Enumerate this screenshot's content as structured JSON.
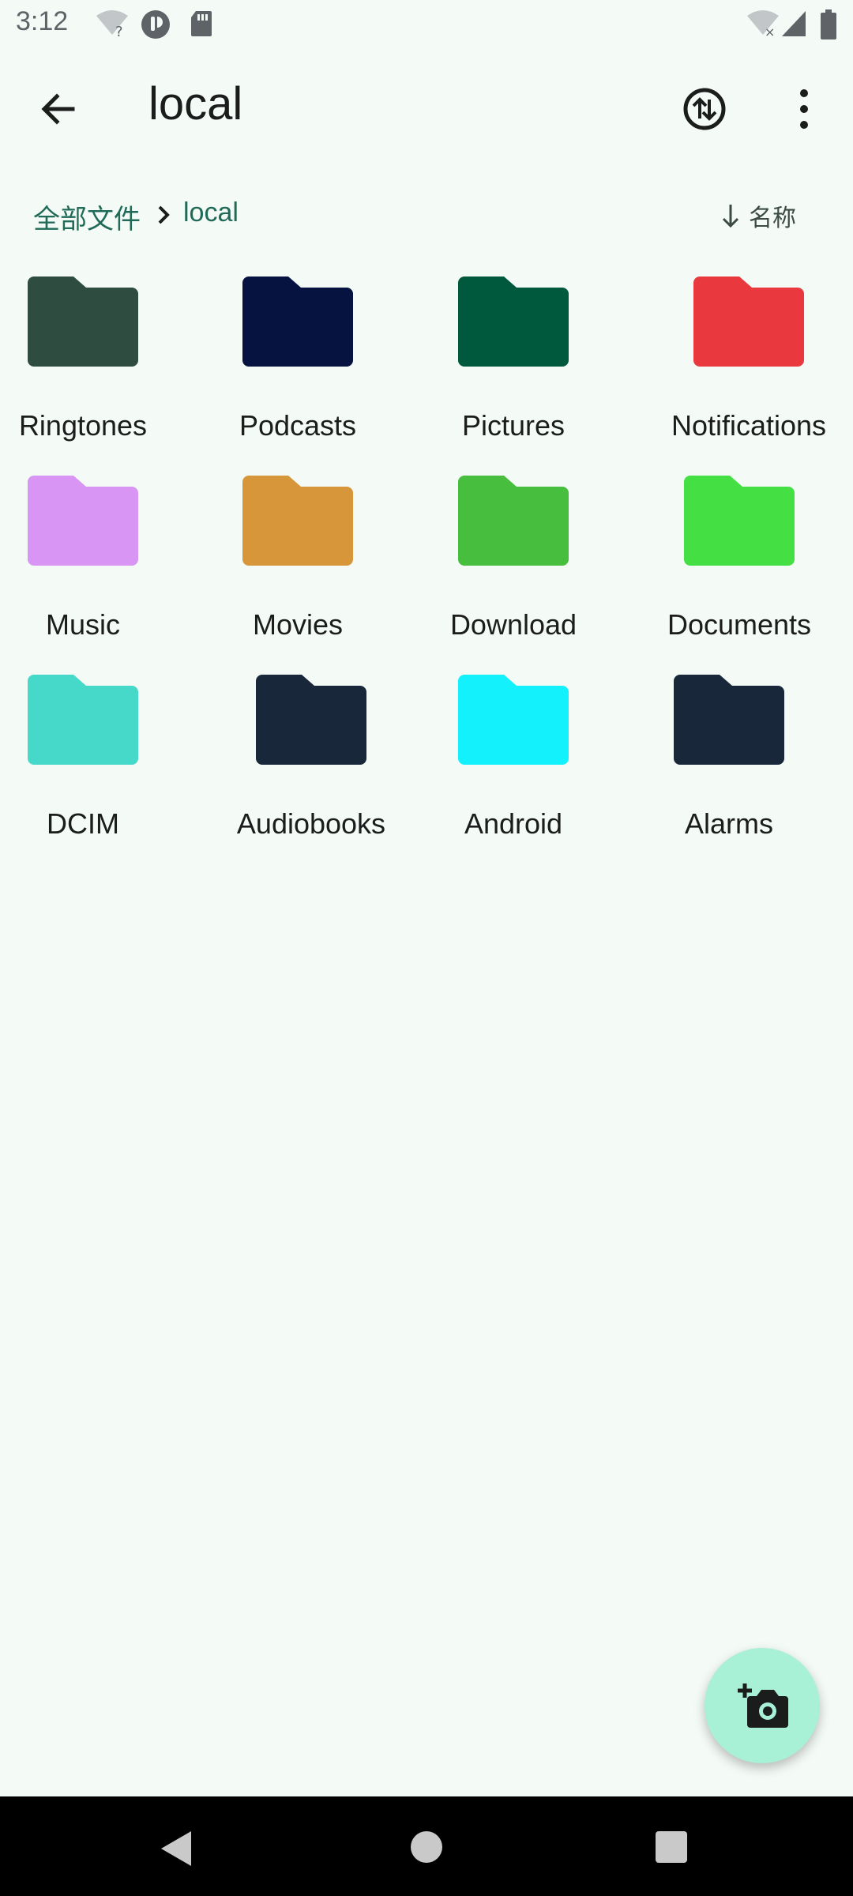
{
  "status_bar": {
    "time": "3:12",
    "icons": [
      "wifi-question-icon",
      "clock-badge-icon",
      "sd-card-icon",
      "wifi-off-icon",
      "cell-signal-icon",
      "battery-icon"
    ]
  },
  "app_bar": {
    "title": "local",
    "back_icon": "arrow-back-icon",
    "transfer_icon": "swap-vertical-circle-icon",
    "more_icon": "more-vert-icon"
  },
  "path_bar": {
    "root_label": "全部文件",
    "current_label": "local",
    "sort_label": "名称",
    "sort_direction": "descending",
    "accent_color": "#1f6b58"
  },
  "folders": [
    {
      "name": "Ringtones",
      "color": "#2f4c40"
    },
    {
      "name": "Podcasts",
      "color": "#06123f"
    },
    {
      "name": "Pictures",
      "color": "#00583d"
    },
    {
      "name": "Notifications",
      "color": "#e9393f"
    },
    {
      "name": "Music",
      "color": "#d895f3"
    },
    {
      "name": "Movies",
      "color": "#d8963a"
    },
    {
      "name": "Download",
      "color": "#48be3f"
    },
    {
      "name": "Documents",
      "color": "#43df43"
    },
    {
      "name": "DCIM",
      "color": "#46d8c8"
    },
    {
      "name": "Audiobooks",
      "color": "#19273a"
    },
    {
      "name": "Android",
      "color": "#13f2fc"
    },
    {
      "name": "Alarms",
      "color": "#19273a"
    }
  ],
  "fab": {
    "icon": "add-a-photo-icon",
    "color": "#a8f0d6"
  },
  "nav_bar": {
    "icons": [
      "nav-back-icon",
      "nav-home-icon",
      "nav-recents-icon"
    ]
  }
}
